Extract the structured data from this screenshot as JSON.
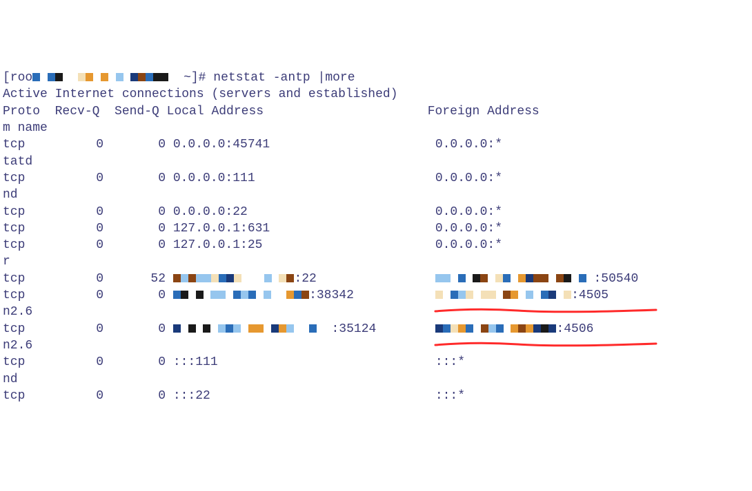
{
  "prompt": {
    "prefix": "[roo",
    "suffix": " ~]# ",
    "command": "netstat -antp |more"
  },
  "banner": "Active Internet connections (servers and established)",
  "headers": {
    "proto": "Proto",
    "recvq": "Recv-Q",
    "sendq": "Send-Q",
    "local": "Local Address",
    "foreign": "Foreign Address"
  },
  "header_cont": "m name",
  "rows": [
    {
      "proto": "tcp",
      "recvq": "0",
      "sendq": "0",
      "local": "0.0.0.0:45741",
      "foreign": "0.0.0.0:*",
      "cont": "tatd",
      "local_pix": false,
      "foreign_pix": false
    },
    {
      "proto": "tcp",
      "recvq": "0",
      "sendq": "0",
      "local": "0.0.0.0:111",
      "foreign": "0.0.0.0:*",
      "cont": "nd",
      "local_pix": false,
      "foreign_pix": false
    },
    {
      "proto": "tcp",
      "recvq": "0",
      "sendq": "0",
      "local": "0.0.0.0:22",
      "foreign": "0.0.0.0:*",
      "cont": "",
      "local_pix": false,
      "foreign_pix": false
    },
    {
      "proto": "tcp",
      "recvq": "0",
      "sendq": "0",
      "local": "127.0.0.1:631",
      "foreign": "0.0.0.0:*",
      "cont": "",
      "local_pix": false,
      "foreign_pix": false
    },
    {
      "proto": "tcp",
      "recvq": "0",
      "sendq": "0",
      "local": "127.0.0.1:25",
      "foreign": "0.0.0.0:*",
      "cont": "r",
      "local_pix": false,
      "foreign_pix": false
    },
    {
      "proto": "tcp",
      "recvq": "0",
      "sendq": "52",
      "local": ":22",
      "foreign": ":50540",
      "cont": "",
      "local_pix": true,
      "foreign_pix": true
    },
    {
      "proto": "tcp",
      "recvq": "0",
      "sendq": "0",
      "local": ":38342",
      "foreign": ":4505",
      "cont": "n2.6",
      "local_pix": true,
      "foreign_pix": true,
      "underline": true
    },
    {
      "proto": "tcp",
      "recvq": "0",
      "sendq": "0",
      "local": ":35124",
      "foreign": ":4506",
      "cont": "n2.6",
      "local_pix": true,
      "foreign_pix": true,
      "underline": true
    },
    {
      "proto": "tcp",
      "recvq": "0",
      "sendq": "0",
      "local": ":::111",
      "foreign": ":::*",
      "cont": "nd",
      "local_pix": false,
      "foreign_pix": false
    },
    {
      "proto": "tcp",
      "recvq": "0",
      "sendq": "0",
      "local": ":::22",
      "foreign": ":::*",
      "cont": "",
      "local_pix": false,
      "foreign_pix": false
    }
  ]
}
